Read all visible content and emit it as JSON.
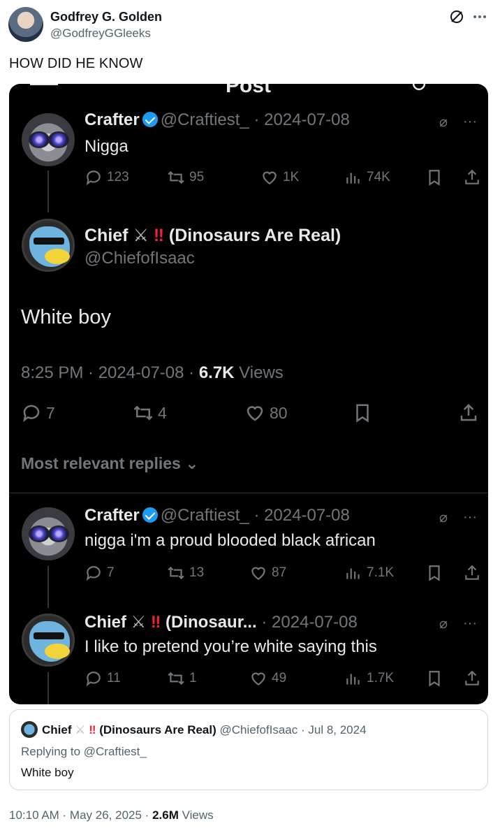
{
  "outer": {
    "name": "Godfrey G. Golden",
    "handle": "@GodfreyGGleeks",
    "text": "HOW DID HE KNOW",
    "timestamp": "10:10 AM · May 26, 2025 · ",
    "views_count": "2.6M",
    "views_label": "Views"
  },
  "screenshot": {
    "partial_title": "Post",
    "tweet1": {
      "name": "Crafter",
      "handle_date": "@Craftiest_ · 2024-07-08",
      "text": "Nigga",
      "replies": "123",
      "retweets": "95",
      "likes": "1K",
      "views": "74K"
    },
    "main": {
      "name": "Chief",
      "sword": "⚔",
      "bang": "‼",
      "suffix": "(Dinosaurs Are Real)",
      "handle": "@ChiefofIsaac",
      "text": "White boy",
      "time": "8:25 PM · 2024-07-08 · ",
      "views_count": "6.7K",
      "views_label": " Views",
      "replies": "7",
      "retweets": "4",
      "likes": "80"
    },
    "most_relevant": "Most relevant replies",
    "reply1": {
      "name": "Crafter",
      "handle_date": "@Craftiest_ · 2024-07-08",
      "text": "nigga i'm a proud blooded black african",
      "replies": "7",
      "retweets": "13",
      "likes": "87",
      "views": "7.1K"
    },
    "reply2": {
      "name": "Chief",
      "suffix": "(Dinosaur...",
      "date": " · 2024-07-08",
      "text": "I like to pretend you’re white saying this",
      "replies": "11",
      "retweets": "1",
      "likes": "49",
      "views": "1.7K"
    }
  },
  "quote": {
    "name": "Chief",
    "suffix": "(Dinosaurs Are Real)",
    "meta": "@ChiefofIsaac · Jul 8, 2024",
    "replying": "Replying to @Craftiest_",
    "text": "White boy"
  },
  "colors": {
    "dark_bg": "#000000",
    "muted": "#71767b",
    "verified": "#1d9bf0",
    "text_light": "#e7e9ea"
  }
}
